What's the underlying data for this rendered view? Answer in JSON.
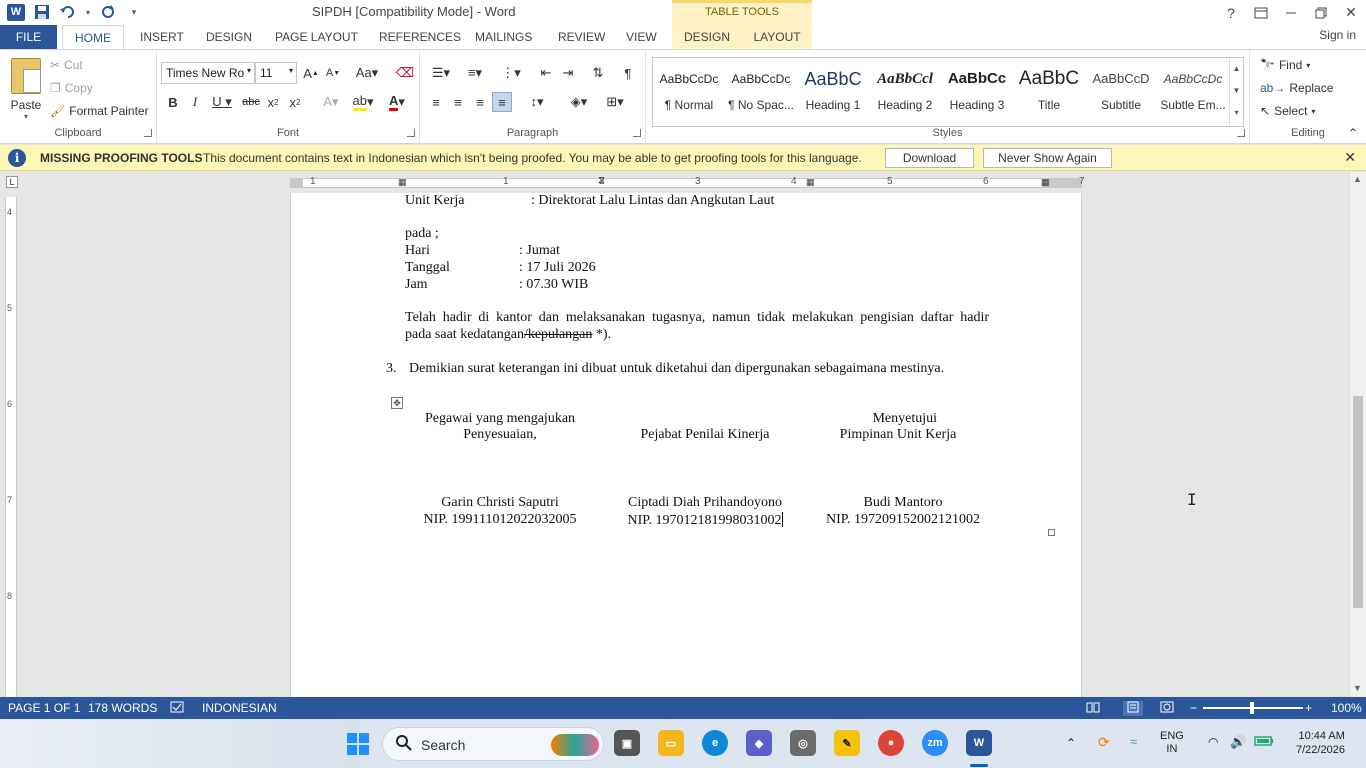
{
  "window": {
    "title": "SIPDH [Compatibility Mode] - Word",
    "table_tools": "TABLE TOOLS",
    "signin": "Sign in"
  },
  "tabs": {
    "file": "FILE",
    "home": "HOME",
    "insert": "INSERT",
    "design": "DESIGN",
    "page_layout": "PAGE LAYOUT",
    "references": "REFERENCES",
    "mailings": "MAILINGS",
    "review": "REVIEW",
    "view": "VIEW",
    "tt_design": "DESIGN",
    "tt_layout": "LAYOUT"
  },
  "clipboard": {
    "paste": "Paste",
    "cut": "Cut",
    "copy": "Copy",
    "format_painter": "Format Painter",
    "label": "Clipboard"
  },
  "font": {
    "name": "Times New Ro",
    "size": "11",
    "label": "Font"
  },
  "paragraph": {
    "label": "Paragraph"
  },
  "styles": {
    "label": "Styles",
    "items": [
      {
        "preview": "AaBbCcDc",
        "name": "¶ Normal"
      },
      {
        "preview": "AaBbCcDc",
        "name": "¶ No Spac..."
      },
      {
        "preview": "AaBbC",
        "name": "Heading 1"
      },
      {
        "preview": "AaBbCcl",
        "name": "Heading 2"
      },
      {
        "preview": "AaBbCc",
        "name": "Heading 3"
      },
      {
        "preview": "AaBbC",
        "name": "Title"
      },
      {
        "preview": "AaBbCcD",
        "name": "Subtitle"
      },
      {
        "preview": "AaBbCcDc",
        "name": "Subtle Em..."
      }
    ]
  },
  "editing": {
    "find": "Find",
    "replace": "Replace",
    "select": "Select",
    "label": "Editing"
  },
  "message_bar": {
    "title": "MISSING PROOFING TOOLS",
    "text": "This document contains text in Indonesian which isn't being proofed. You may be able to get proofing tools for this language.",
    "download": "Download",
    "never_show": "Never Show Again"
  },
  "ruler": {
    "h_numbers": [
      "1",
      "1",
      "2",
      "3",
      "4",
      "5",
      "6",
      "7"
    ],
    "v_numbers": [
      "4",
      "5",
      "6",
      "7",
      "8"
    ]
  },
  "document": {
    "unit_kerja_label": "Unit Kerja",
    "unit_kerja_value": ": Direktorat Lalu Lintas dan Angkutan Laut",
    "pada": "pada ;",
    "hari_label": "Hari",
    "hari_value": ": Jumat",
    "tanggal_label": "Tanggal",
    "tanggal_value": ": 17 Juli 2026",
    "jam_label": "Jam",
    "jam_value": ": 07.30 WIB",
    "para1_line1": "Telah hadir di kantor dan melaksanakan tugasnya, namun tidak melakukan pengisian daftar hadir",
    "para1_line2_a": "pada saat kedatangan",
    "para1_line2_strike": "/kepulangan",
    "para1_line2_b": " *).",
    "item3_number": "3.",
    "item3_text": "Demikian surat keterangan ini dibuat untuk diketahui dan dipergunakan sebagaimana mestinya.",
    "sig_col1_line1": "Pegawai yang mengajukan",
    "sig_col1_line2": "Penyesuaian,",
    "sig_col2_line1": "Pejabat Penilai Kinerja",
    "sig_col3_line1": "Menyetujui",
    "sig_col3_line2": "Pimpinan Unit Kerja",
    "name1": "Garin Christi Saputri",
    "nip1": "NIP. 199111012022032005",
    "name2": "Ciptadi Diah Prihandoyono",
    "nip2": "NIP. 197012181998031002",
    "name3": "Budi Mantoro",
    "nip3": "NIP. 197209152002121002"
  },
  "status_bar": {
    "page": "PAGE 1 OF 1",
    "words": "178 WORDS",
    "language": "INDONESIAN",
    "zoom": "100%",
    "zoom_percent": 100
  },
  "taskbar": {
    "search": "Search",
    "lang_line1": "ENG",
    "lang_line2": "IN",
    "time": "10:44 AM",
    "date": "7/22/2026",
    "zoom_app": "zm"
  },
  "colors": {
    "accent": "#2b579a",
    "message_bar": "#fcf7b6",
    "table_tools": "#fdf3c7"
  }
}
